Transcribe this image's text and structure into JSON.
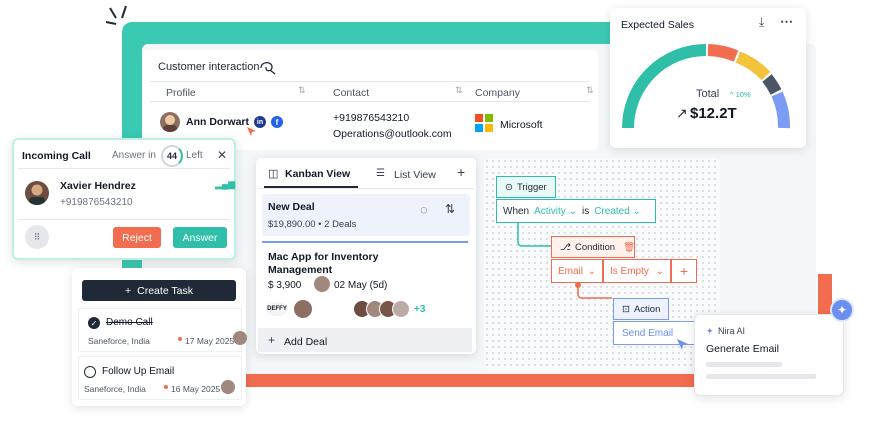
{
  "customer": {
    "title": "Customer interaction",
    "columns": [
      "Profile",
      "Contact",
      "Company"
    ],
    "row": {
      "name": "Ann Dorwart",
      "phone": "+919876543210",
      "email": "Operations@outlook.com",
      "company": "Microsoft"
    }
  },
  "incoming": {
    "title": "Incoming Call",
    "answer_in": "Answer in",
    "seconds": "44",
    "left": "Left",
    "caller": "Xavier Hendrez",
    "phone": "+919876543210",
    "reject": "Reject",
    "answer": "Answer"
  },
  "kanban": {
    "tab_kanban": "Kanban View",
    "tab_list": "List View",
    "stage": "New Deal",
    "stage_summary": "$19,890.00 • 2 Deals",
    "deal_title": "Mac App for Inventory Management",
    "deal_amount": "$ 3,900",
    "deal_date": "02 May (5d)",
    "deal_logo": "DEFFY",
    "more_count": "+3",
    "add_deal": "Add Deal"
  },
  "flow": {
    "trigger": "Trigger",
    "when": "When",
    "activity": "Activity",
    "is": "is",
    "created": "Created",
    "condition": "Condition",
    "email": "Email",
    "is_empty": "Is Empty",
    "action": "Action",
    "send_email": "Send Email"
  },
  "tasks": {
    "create": "Create Task",
    "items": [
      {
        "title": "Demo Call",
        "location": "Saneforce, India",
        "date": "17 May 2025",
        "done": true
      },
      {
        "title": "Follow Up Email",
        "location": "Saneforce, India",
        "date": "16 May 2025",
        "done": false
      }
    ]
  },
  "sales": {
    "title": "Expected Sales",
    "total_label": "Total",
    "change": "10%",
    "value": "$12.2T"
  },
  "nira": {
    "brand": "Nira AI",
    "action": "Generate Email"
  },
  "colors": {
    "teal": "#3cc9b4",
    "orange": "#f26d4f",
    "blue": "#6b8ef0",
    "dark": "#1f2937",
    "gauge": [
      "#2fbfa9",
      "#f26d4f",
      "#f5c23b",
      "#4b5563",
      "#7b9cf2"
    ]
  },
  "icons": [
    "search-icon",
    "download-icon",
    "more-icon",
    "linkedin-icon",
    "facebook-icon",
    "close-icon",
    "signal-icon",
    "keypad-icon",
    "kanban-icon",
    "list-icon",
    "plus-icon",
    "spinner-icon",
    "sort-icon",
    "trigger-icon",
    "condition-icon",
    "delete-icon",
    "action-icon",
    "sparkle-icon",
    "check-icon"
  ]
}
